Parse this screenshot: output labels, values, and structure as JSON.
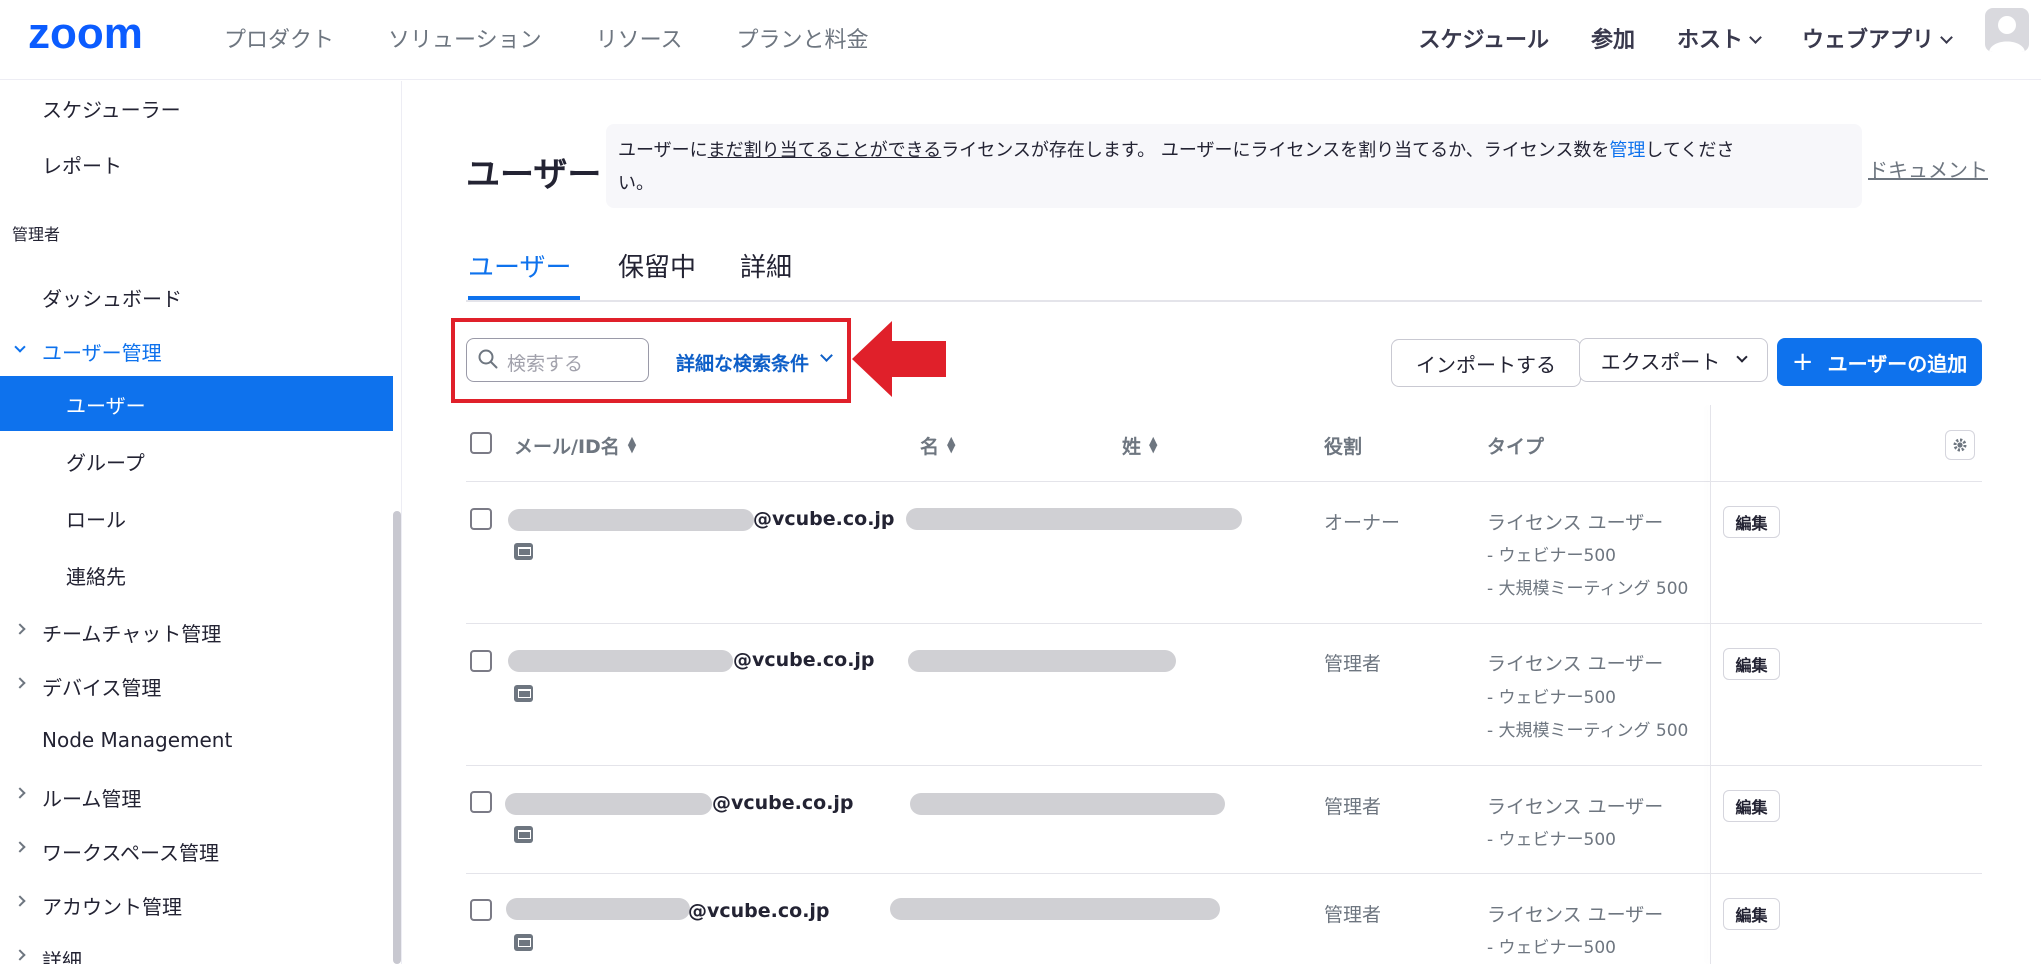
{
  "nav": {
    "logo": "zoom",
    "left_items": [
      "プロダクト",
      "ソリューション",
      "リソース",
      "プランと料金"
    ],
    "right_items": [
      "スケジュール",
      "参加",
      "ホスト",
      "ウェブアプリ"
    ]
  },
  "sidebar": {
    "top_items": [
      "スケジューラー",
      "レポート"
    ],
    "section_header": "管理者",
    "dashboard": "ダッシュボード",
    "user_mgmt": "ユーザー管理",
    "sub_items": [
      "ユーザー",
      "グループ",
      "ロール",
      "連絡先"
    ],
    "more_items": [
      "チームチャット管理",
      "デバイス管理",
      "Node Management",
      "ルーム管理",
      "ワークスペース管理",
      "アカウント管理",
      "詳細"
    ]
  },
  "main": {
    "title": "ユーザー",
    "notice": {
      "part1": "ユーザーに",
      "underlined": "まだ割り当てることができる",
      "part2": "ライセンスが存在します。 ユーザーにライセンスを割り当てるか、ライセンス数を",
      "link": "管理",
      "part3": "してくださ",
      "part4": "い。"
    },
    "doc_link": "ドキュメント",
    "tabs": [
      "ユーザー",
      "保留中",
      "詳細"
    ],
    "search_placeholder": "検索する",
    "advanced_search": "詳細な検索条件",
    "import_label": "インポートする",
    "export_label": "エクスポート",
    "add_user_label": "ユーザーの追加"
  },
  "table": {
    "headers": [
      "メール/ID名",
      "名",
      "姓",
      "役割",
      "タイプ"
    ],
    "rows": [
      {
        "email_domain": "@vcube.co.jp",
        "role": "オーナー",
        "type": "ライセンス ユーザー",
        "addons": [
          "- ウェビナー500",
          "- 大規模ミーティング 500"
        ],
        "edit": "編集"
      },
      {
        "email_domain": "@vcube.co.jp",
        "role": "管理者",
        "type": "ライセンス ユーザー",
        "addons": [
          "- ウェビナー500",
          "- 大規模ミーティング 500"
        ],
        "edit": "編集"
      },
      {
        "email_domain": "@vcube.co.jp",
        "role": "管理者",
        "type": "ライセンス ユーザー",
        "addons": [
          "- ウェビナー500"
        ],
        "edit": "編集"
      },
      {
        "email_domain": "@vcube.co.jp",
        "role": "管理者",
        "type": "ライセンス ユーザー",
        "addons": [
          "- ウェビナー500"
        ],
        "edit": "編集"
      }
    ]
  },
  "colors": {
    "brand": "#0b5cff",
    "accent": "#0e72ed",
    "highlight": "#e0202a"
  }
}
